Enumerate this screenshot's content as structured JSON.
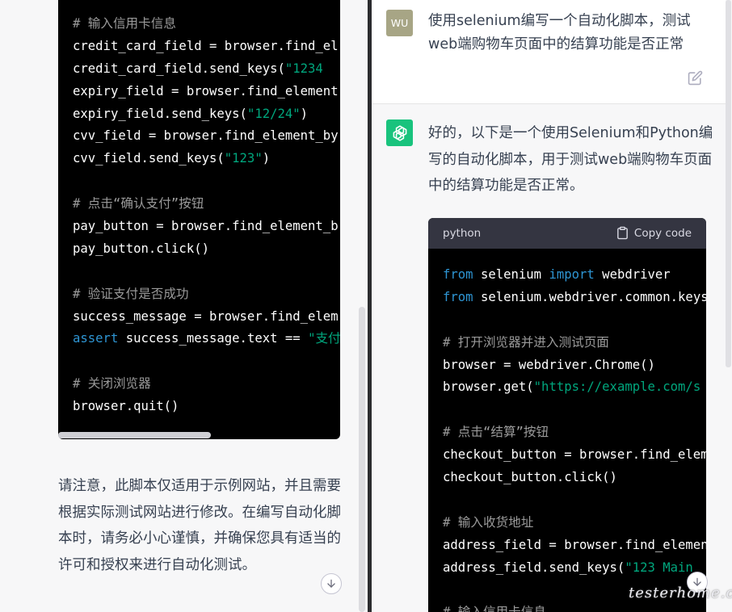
{
  "left_panel": {
    "code_lines": [
      {
        "parts": [
          {
            "t": "# 输入信用卡信息",
            "c": "com"
          }
        ]
      },
      {
        "parts": [
          {
            "t": "credit_card_field = browser.find_el",
            "c": ""
          }
        ]
      },
      {
        "parts": [
          {
            "t": "credit_card_field.send_keys(",
            "c": ""
          },
          {
            "t": "\"1234 ",
            "c": "str"
          }
        ]
      },
      {
        "parts": [
          {
            "t": "expiry_field = browser.find_element",
            "c": ""
          }
        ]
      },
      {
        "parts": [
          {
            "t": "expiry_field.send_keys(",
            "c": ""
          },
          {
            "t": "\"12/24\"",
            "c": "str"
          },
          {
            "t": ")",
            "c": ""
          }
        ]
      },
      {
        "parts": [
          {
            "t": "cvv_field = browser.find_element_by",
            "c": ""
          }
        ]
      },
      {
        "parts": [
          {
            "t": "cvv_field.send_keys(",
            "c": ""
          },
          {
            "t": "\"123\"",
            "c": "str"
          },
          {
            "t": ")",
            "c": ""
          }
        ]
      },
      {
        "parts": [
          {
            "t": "",
            "c": ""
          }
        ]
      },
      {
        "parts": [
          {
            "t": "# 点击“确认支付”按钮",
            "c": "com"
          }
        ]
      },
      {
        "parts": [
          {
            "t": "pay_button = browser.find_element_b",
            "c": ""
          }
        ]
      },
      {
        "parts": [
          {
            "t": "pay_button.click()",
            "c": ""
          }
        ]
      },
      {
        "parts": [
          {
            "t": "",
            "c": ""
          }
        ]
      },
      {
        "parts": [
          {
            "t": "# 验证支付是否成功",
            "c": "com"
          }
        ]
      },
      {
        "parts": [
          {
            "t": "success_message = browser.find_elem",
            "c": ""
          }
        ]
      },
      {
        "parts": [
          {
            "t": "assert",
            "c": "kw"
          },
          {
            "t": " success_message.text == ",
            "c": ""
          },
          {
            "t": "\"支付",
            "c": "str"
          }
        ]
      },
      {
        "parts": [
          {
            "t": "",
            "c": ""
          }
        ]
      },
      {
        "parts": [
          {
            "t": "# 关闭浏览器",
            "c": "com"
          }
        ]
      },
      {
        "parts": [
          {
            "t": "browser.quit()",
            "c": ""
          }
        ]
      }
    ],
    "note": "请注意，此脚本仅适用于示例网站，并且需要根据实际测试网站进行修改。在编写自动化脚本时，请务必小心谨慎，并确保您具有适当的许可和授权来进行自动化测试。"
  },
  "right_panel": {
    "user_avatar": "WU",
    "user_message": "使用selenium编写一个自动化脚本，测试web端购物车页面中的结算功能是否正常",
    "assistant_message": "好的，以下是一个使用Selenium和Python编写的自动化脚本，用于测试web端购物车页面中的结算功能是否正常。",
    "code_block": {
      "language": "python",
      "copy_label": "Copy code",
      "lines": [
        {
          "parts": [
            {
              "t": "from",
              "c": "kw"
            },
            {
              "t": " selenium ",
              "c": ""
            },
            {
              "t": "import",
              "c": "kw"
            },
            {
              "t": " webdriver",
              "c": ""
            }
          ]
        },
        {
          "parts": [
            {
              "t": "from",
              "c": "kw"
            },
            {
              "t": " selenium.webdriver.common.keys",
              "c": ""
            }
          ]
        },
        {
          "parts": [
            {
              "t": "",
              "c": ""
            }
          ]
        },
        {
          "parts": [
            {
              "t": "# 打开浏览器并进入测试页面",
              "c": "com"
            }
          ]
        },
        {
          "parts": [
            {
              "t": "browser = webdriver.Chrome()",
              "c": ""
            }
          ]
        },
        {
          "parts": [
            {
              "t": "browser.get(",
              "c": ""
            },
            {
              "t": "\"https://example.com/s",
              "c": "str"
            }
          ]
        },
        {
          "parts": [
            {
              "t": "",
              "c": ""
            }
          ]
        },
        {
          "parts": [
            {
              "t": "# 点击“结算”按钮",
              "c": "com"
            }
          ]
        },
        {
          "parts": [
            {
              "t": "checkout_button = browser.find_elem",
              "c": ""
            }
          ]
        },
        {
          "parts": [
            {
              "t": "checkout_button.click()",
              "c": ""
            }
          ]
        },
        {
          "parts": [
            {
              "t": "",
              "c": ""
            }
          ]
        },
        {
          "parts": [
            {
              "t": "# 输入收货地址",
              "c": "com"
            }
          ]
        },
        {
          "parts": [
            {
              "t": "address_field = browser.find_elemen",
              "c": ""
            }
          ]
        },
        {
          "parts": [
            {
              "t": "address_field.send_keys(",
              "c": ""
            },
            {
              "t": "\"123 Main",
              "c": "str"
            }
          ]
        },
        {
          "parts": [
            {
              "t": "",
              "c": ""
            }
          ]
        },
        {
          "parts": [
            {
              "t": "# 输入信用卡信息",
              "c": "com"
            }
          ]
        }
      ]
    },
    "watermark": "testerhome.com"
  },
  "icons": {
    "edit": "edit-icon",
    "copy": "clipboard-icon",
    "scroll_down": "arrow-down-icon",
    "assistant": "openai-logo-icon"
  },
  "colors": {
    "code_bg": "#000000",
    "code_header_bg": "#343541",
    "comment": "#9a9a9a",
    "string": "#00a67d",
    "keyword": "#2e95d3",
    "assistant_avatar": "#19c37d",
    "user_avatar": "#a7a585"
  }
}
